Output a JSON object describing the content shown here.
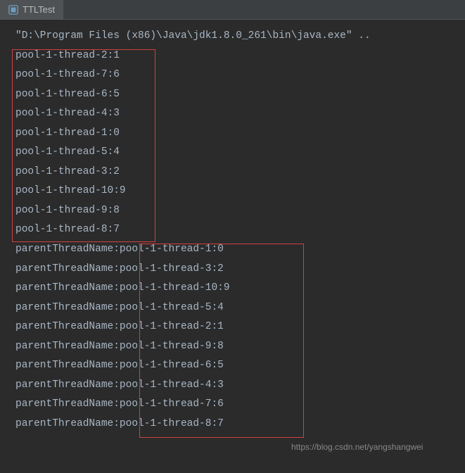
{
  "tab": {
    "title": "TTLTest"
  },
  "console": {
    "command": "\"D:\\Program Files (x86)\\Java\\jdk1.8.0_261\\bin\\java.exe\" ..",
    "block1": [
      "pool-1-thread-2:1",
      "pool-1-thread-7:6",
      "pool-1-thread-6:5",
      "pool-1-thread-4:3",
      "pool-1-thread-1:0",
      "pool-1-thread-5:4",
      "pool-1-thread-3:2",
      "pool-1-thread-10:9",
      "pool-1-thread-9:8",
      "pool-1-thread-8:7"
    ],
    "block2": [
      "parentThreadName:pool-1-thread-1:0",
      "parentThreadName:pool-1-thread-3:2",
      "parentThreadName:pool-1-thread-10:9",
      "parentThreadName:pool-1-thread-5:4",
      "parentThreadName:pool-1-thread-2:1",
      "parentThreadName:pool-1-thread-9:8",
      "parentThreadName:pool-1-thread-6:5",
      "parentThreadName:pool-1-thread-4:3",
      "parentThreadName:pool-1-thread-7:6",
      "parentThreadName:pool-1-thread-8:7"
    ]
  },
  "watermark": "https://blog.csdn.net/yangshangwei"
}
